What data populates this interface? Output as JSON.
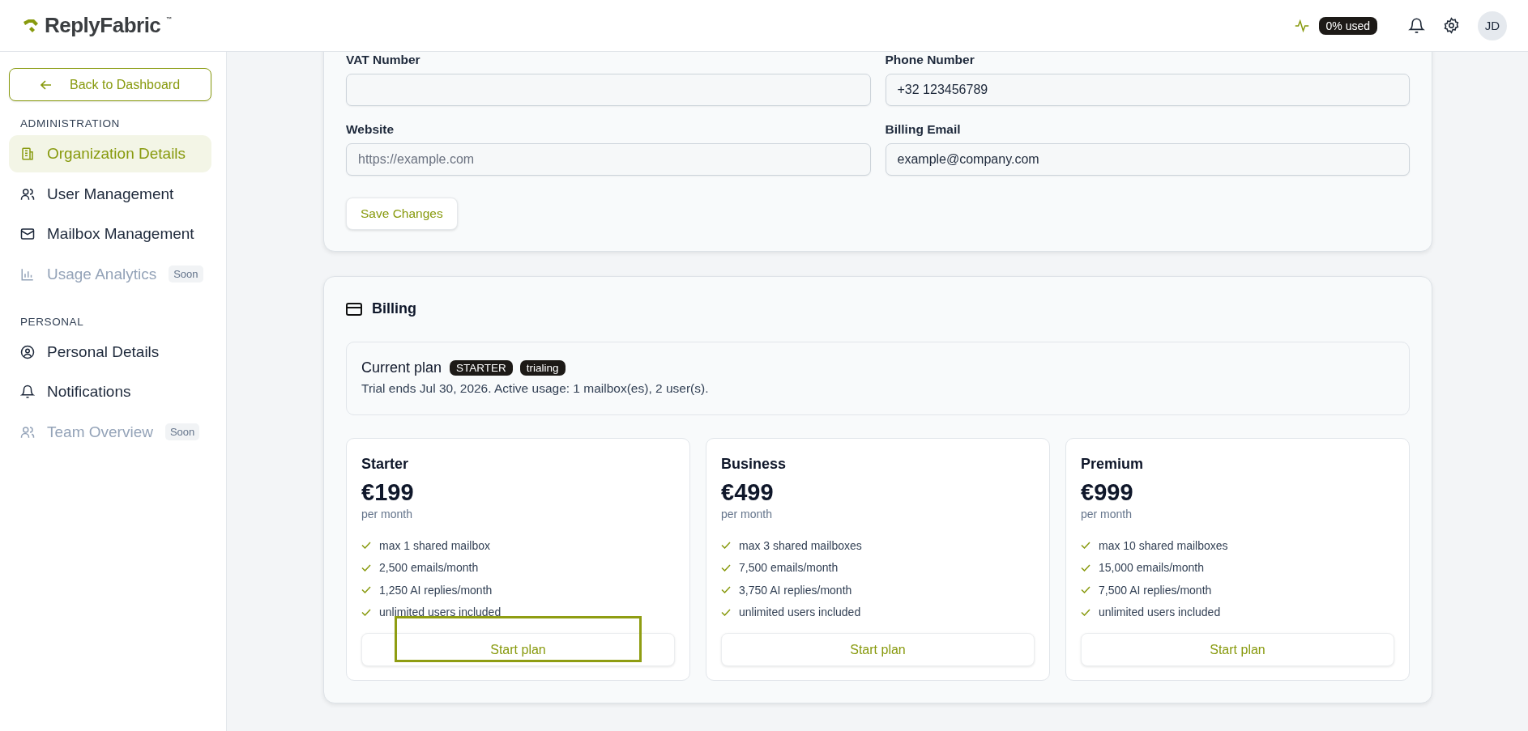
{
  "header": {
    "brand": "ReplyFabric",
    "trademark": "™",
    "usage": "0% used",
    "avatar": "JD"
  },
  "sidebar": {
    "back_button": "Back to Dashboard",
    "sections": [
      {
        "title": "ADMINISTRATION",
        "items": [
          {
            "label": "Organization Details",
            "selected": true,
            "disabled": false
          },
          {
            "label": "User Management",
            "selected": false,
            "disabled": false
          },
          {
            "label": "Mailbox Management",
            "selected": false,
            "disabled": false
          },
          {
            "label": "Usage Analytics",
            "selected": false,
            "disabled": true,
            "badge": "Soon"
          }
        ]
      },
      {
        "title": "PERSONAL",
        "items": [
          {
            "label": "Personal Details",
            "selected": false,
            "disabled": false
          },
          {
            "label": "Notifications",
            "selected": false,
            "disabled": false
          },
          {
            "label": "Team Overview",
            "selected": false,
            "disabled": true,
            "badge": "Soon"
          }
        ]
      }
    ]
  },
  "organization_form": {
    "fields": [
      {
        "label": "VAT Number"
      },
      {
        "label": "Phone Number",
        "value": "+32 123456789"
      },
      {
        "label": "Website",
        "placeholder": "https://example.com"
      },
      {
        "label": "Billing Email",
        "value": "example@company.com"
      }
    ],
    "save_button": "Save Changes"
  },
  "billing": {
    "title": "Billing",
    "current_plan": {
      "label": "Current plan",
      "badges": [
        "STARTER",
        "trialing"
      ],
      "note": "Trial ends Jul 30, 2026. Active usage: 1 mailbox(es), 2 user(s)."
    },
    "plans": [
      {
        "name": "Starter",
        "price": "€199",
        "period": "per month",
        "features": [
          "max 1 shared mailbox",
          "2,500 emails/month",
          "1,250 AI replies/month",
          "unlimited users included"
        ],
        "button": "Start plan",
        "highlighted": true
      },
      {
        "name": "Business",
        "price": "€499",
        "period": "per month",
        "features": [
          "max 3 shared mailboxes",
          "7,500 emails/month",
          "3,750 AI replies/month",
          "unlimited users included"
        ],
        "button": "Start plan",
        "highlighted": false
      },
      {
        "name": "Premium",
        "price": "€999",
        "period": "per month",
        "features": [
          "max 10 shared mailboxes",
          "15,000 emails/month",
          "7,500 AI replies/month",
          "unlimited users included"
        ],
        "button": "Start plan",
        "highlighted": false
      }
    ]
  }
}
